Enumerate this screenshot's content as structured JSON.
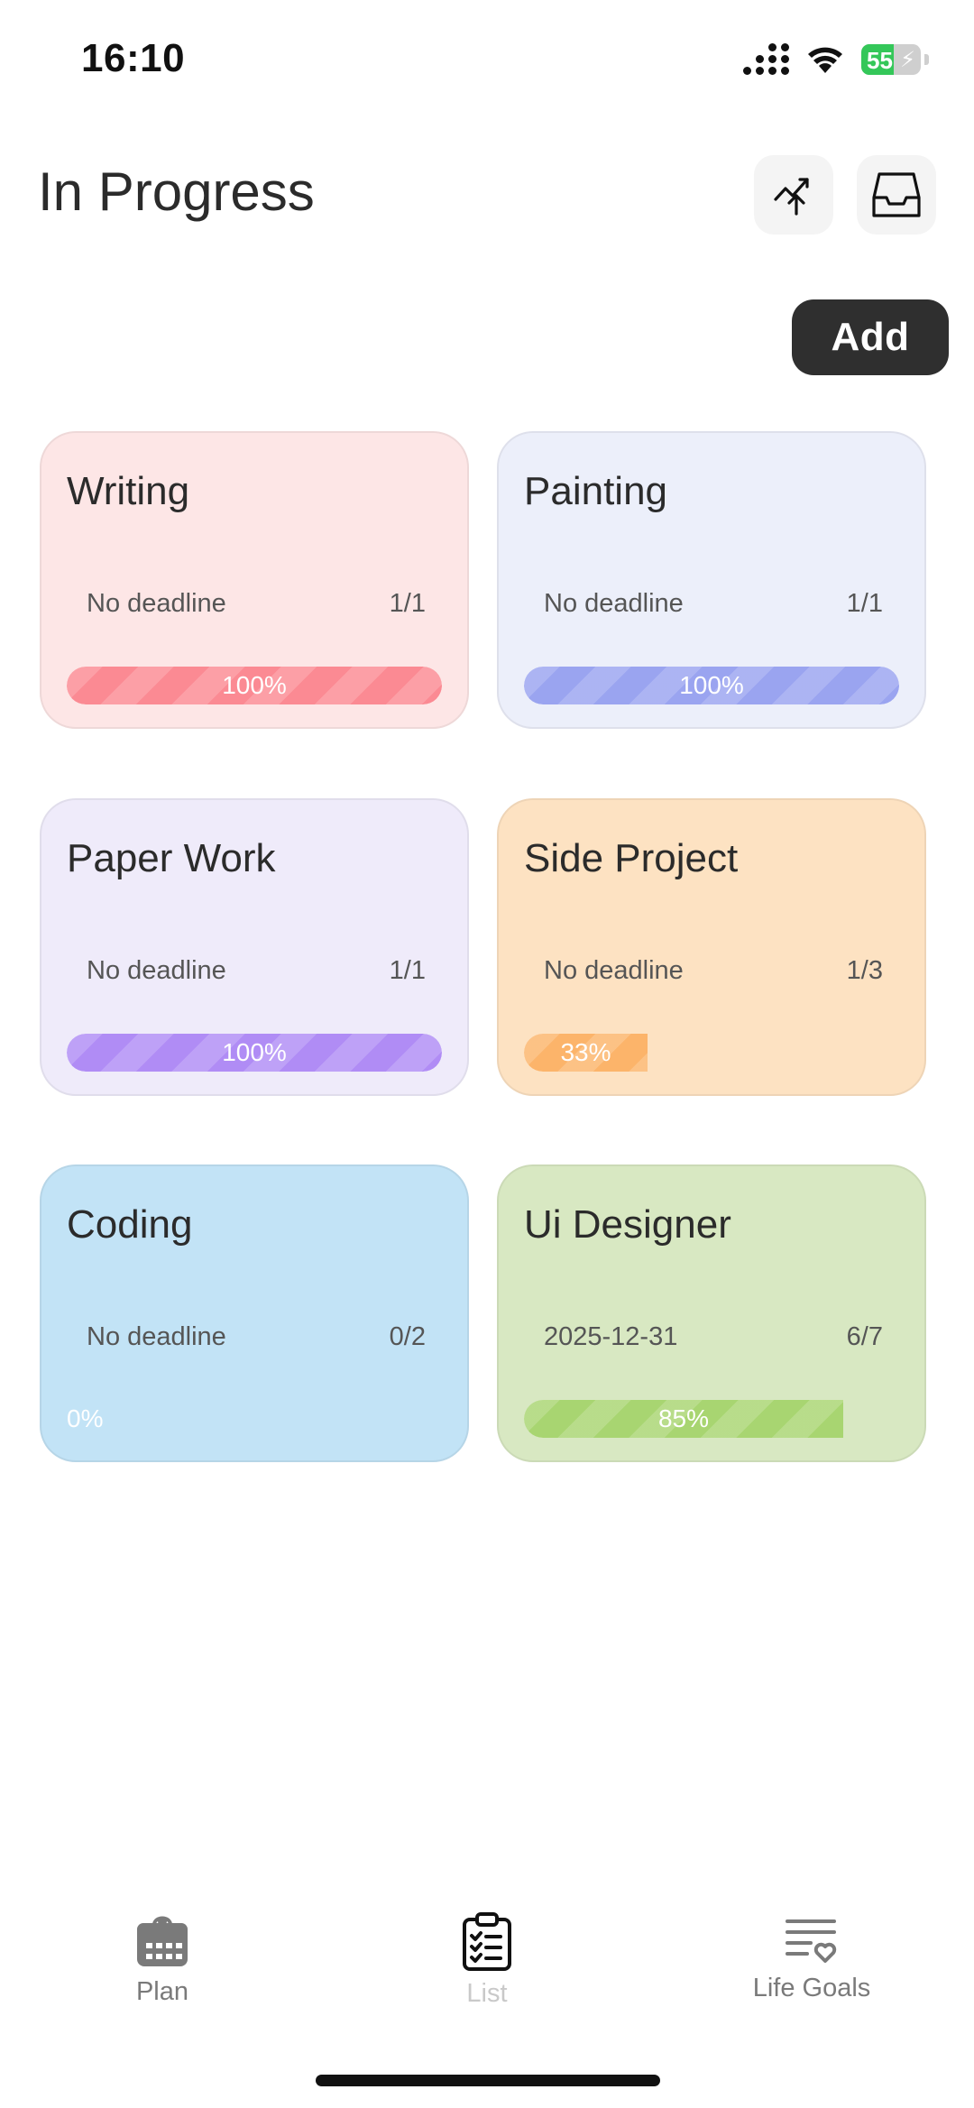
{
  "status_bar": {
    "time": "16:10",
    "battery": "55"
  },
  "header": {
    "title": "In Progress"
  },
  "toolbar": {
    "add_label": "Add"
  },
  "cards": [
    {
      "title": "Writing",
      "deadline": "No deadline",
      "count": "1/1",
      "progress": 1.0,
      "progress_label": "100%",
      "bg": "#fde6e6",
      "bar": "#fb8a93"
    },
    {
      "title": "Painting",
      "deadline": "No deadline",
      "count": "1/1",
      "progress": 1.0,
      "progress_label": "100%",
      "bg": "#eceffa",
      "bar": "#9aa4f0"
    },
    {
      "title": "Paper Work",
      "deadline": "No deadline",
      "count": "1/1",
      "progress": 1.0,
      "progress_label": "100%",
      "bg": "#efebfa",
      "bar": "#b08cf5"
    },
    {
      "title": "Side Project",
      "deadline": "No deadline",
      "count": "1/3",
      "progress": 0.33,
      "progress_label": "33%",
      "bg": "#fde2c2",
      "bar": "#fcb46a"
    },
    {
      "title": "Coding",
      "deadline": "No deadline",
      "count": "0/2",
      "progress": 0.0,
      "progress_label": "0%",
      "bg": "#c2e3f6",
      "bar": "#7cc3ee"
    },
    {
      "title": "Ui Designer",
      "deadline": "2025-12-31",
      "count": "6/7",
      "progress": 0.85,
      "progress_label": "85%",
      "bg": "#d8e8c2",
      "bar": "#a8d571"
    }
  ],
  "tabs": [
    {
      "label": "Plan",
      "icon": "calendar-icon",
      "active": false
    },
    {
      "label": "List",
      "icon": "clipboard-checklist-icon",
      "active": true
    },
    {
      "label": "Life Goals",
      "icon": "goals-list-heart-icon",
      "active": false
    }
  ]
}
